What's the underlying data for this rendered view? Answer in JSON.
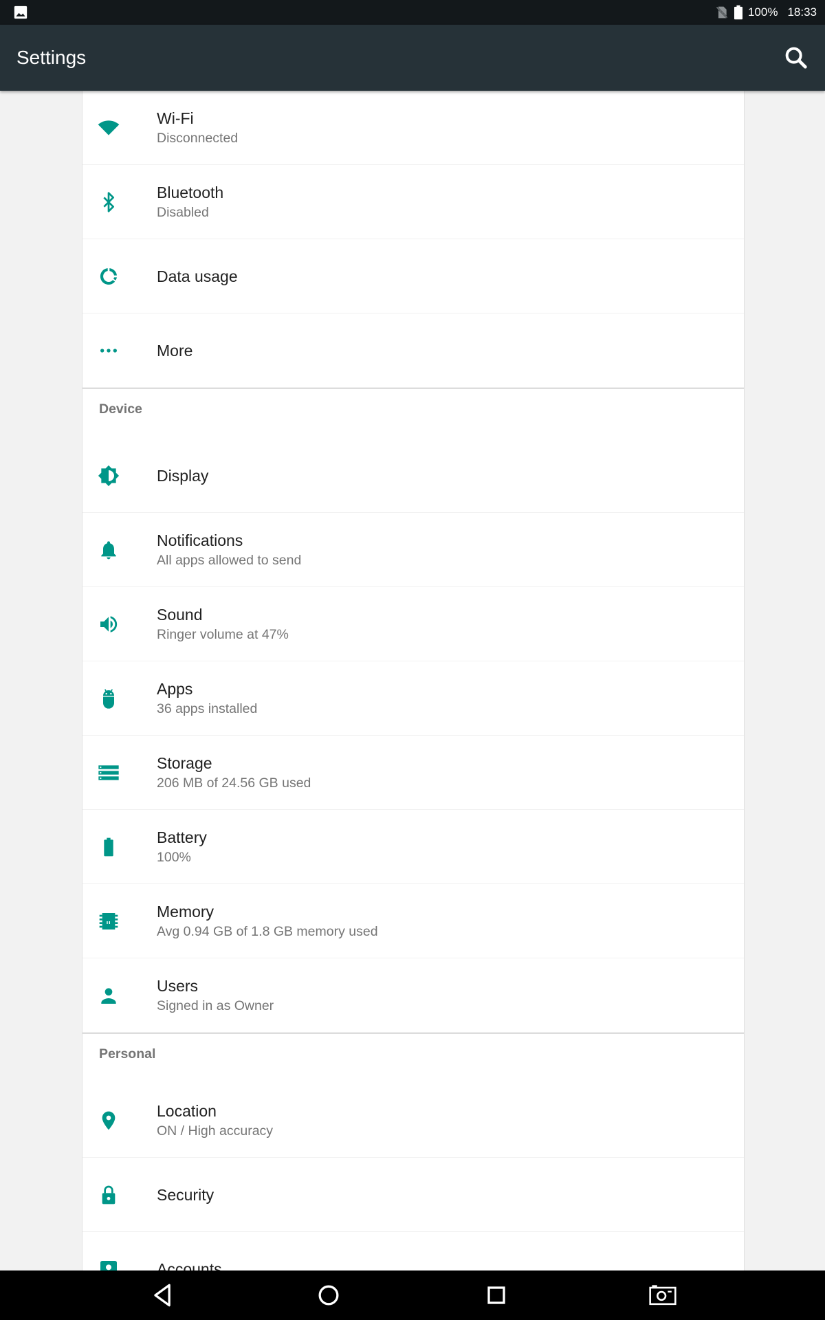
{
  "status_bar": {
    "battery": "100%",
    "time": "18:33",
    "icons": [
      "image-notification-icon",
      "no-sim-icon",
      "battery-icon"
    ]
  },
  "toolbar": {
    "title": "Settings",
    "search_icon": "search-icon"
  },
  "colors": {
    "accent": "#009688",
    "toolbar": "#263238",
    "status_bar": "#13181b",
    "background": "#f2f2f2"
  },
  "wireless": {
    "items": [
      {
        "label": "Wi-Fi",
        "summary": "Disconnected",
        "icon": "wifi-icon"
      },
      {
        "label": "Bluetooth",
        "summary": "Disabled",
        "icon": "bluetooth-icon"
      },
      {
        "label": "Data usage",
        "icon": "data-usage-icon"
      },
      {
        "label": "More",
        "icon": "more-icon"
      }
    ]
  },
  "device": {
    "header": "Device",
    "items": [
      {
        "label": "Display",
        "icon": "display-icon"
      },
      {
        "label": "Notifications",
        "summary": "All apps allowed to send",
        "icon": "bell-icon"
      },
      {
        "label": "Sound",
        "summary": "Ringer volume at 47%",
        "icon": "volume-icon"
      },
      {
        "label": "Apps",
        "summary": "36 apps installed",
        "icon": "android-icon"
      },
      {
        "label": "Storage",
        "summary": "206 MB of 24.56 GB used",
        "icon": "storage-icon"
      },
      {
        "label": "Battery",
        "summary": "100%",
        "icon": "battery-icon"
      },
      {
        "label": "Memory",
        "summary": "Avg 0.94 GB of 1.8 GB memory used",
        "icon": "memory-icon"
      },
      {
        "label": "Users",
        "summary": "Signed in as Owner",
        "icon": "user-icon"
      }
    ]
  },
  "personal": {
    "header": "Personal",
    "items": [
      {
        "label": "Location",
        "summary": "ON / High accuracy",
        "icon": "location-icon"
      },
      {
        "label": "Security",
        "icon": "lock-icon"
      },
      {
        "label": "Accounts",
        "icon": "account-icon"
      }
    ]
  },
  "nav_bar": {
    "buttons": [
      "back-icon",
      "home-icon",
      "recents-icon",
      "screenshot-icon"
    ]
  }
}
